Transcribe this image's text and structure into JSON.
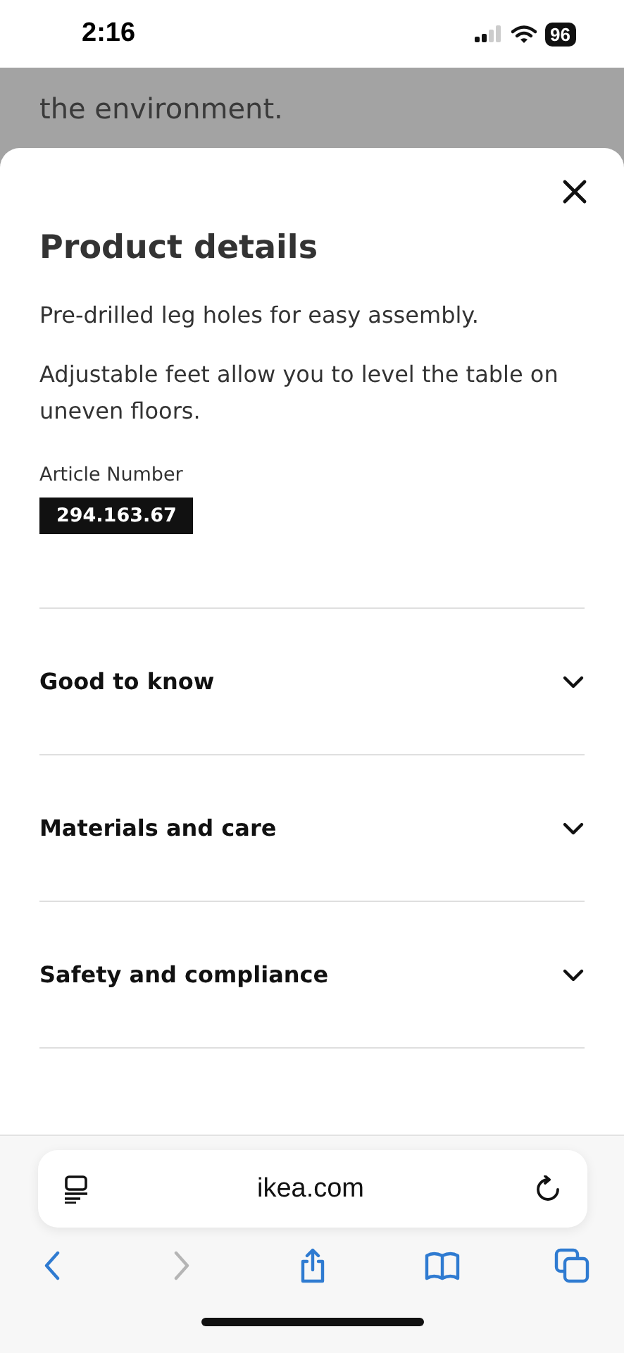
{
  "status_bar": {
    "time": "2:16",
    "battery": "96"
  },
  "background_page": {
    "lines": [
      "the environment."
    ]
  },
  "sheet": {
    "title": "Product details",
    "paragraphs": [
      "Pre-drilled leg holes for easy assembly.",
      "Adjustable feet allow you to level the table on uneven floors."
    ],
    "article_label": "Article Number",
    "article_number": "294.163.67",
    "sections": [
      {
        "label": "Good to know",
        "expanded": false
      },
      {
        "label": "Materials and care",
        "expanded": false
      },
      {
        "label": "Safety and compliance",
        "expanded": false
      }
    ]
  },
  "browser": {
    "address": "ikea.com",
    "toolbar": [
      {
        "kind": "back",
        "disabled": false
      },
      {
        "kind": "forward",
        "disabled": true
      },
      {
        "kind": "share",
        "disabled": false
      },
      {
        "kind": "bookmarks",
        "disabled": false
      },
      {
        "kind": "tabs",
        "disabled": false
      }
    ]
  }
}
